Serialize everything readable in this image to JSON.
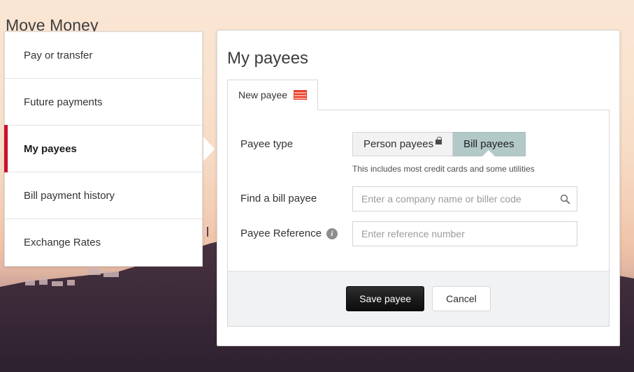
{
  "page": {
    "title": "Move Money",
    "background_color": "#f9e2cf",
    "accent_red": "#c8102e"
  },
  "sidebar": {
    "items": [
      {
        "label": "Pay or transfer",
        "active": false
      },
      {
        "label": "Future payments",
        "active": false
      },
      {
        "label": "My payees",
        "active": true
      },
      {
        "label": "Bill payment history",
        "active": false
      },
      {
        "label": "Exchange Rates",
        "active": false
      }
    ]
  },
  "main": {
    "heading": "My payees",
    "tabs": [
      {
        "label": "New payee",
        "icon": "red-stripes-icon",
        "selected": true
      }
    ],
    "form": {
      "payee_type": {
        "label": "Payee type",
        "options": [
          {
            "label": "Person payees",
            "selected": false,
            "icon": "lock-icon"
          },
          {
            "label": "Bill payees",
            "selected": true,
            "icon": null
          }
        ],
        "hint": "This includes most credit cards and some utilities",
        "selected_color": "#b2c9c7"
      },
      "find_payee": {
        "label": "Find a bill payee",
        "placeholder": "Enter a company name or biller code",
        "value": "",
        "icon": "search-icon"
      },
      "payee_reference": {
        "label": "Payee Reference",
        "placeholder": "Enter reference number",
        "value": "",
        "icon": "info-icon"
      },
      "actions": {
        "save_label": "Save payee",
        "cancel_label": "Cancel"
      }
    }
  }
}
